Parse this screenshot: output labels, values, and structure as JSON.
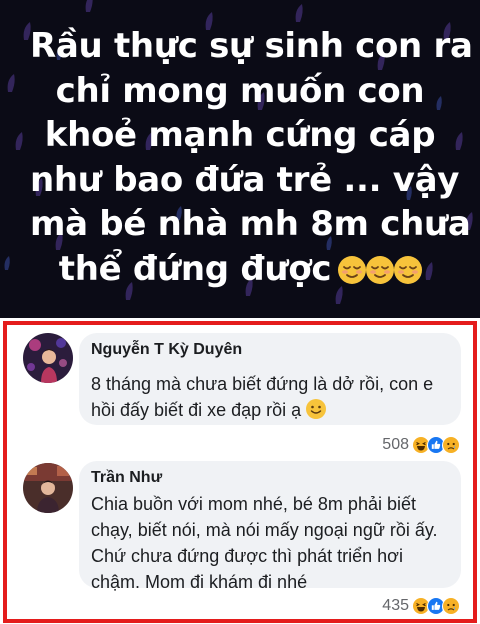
{
  "post": {
    "text_lines": [
      "Rầu thực sự sinh con ra",
      "chỉ mong muốn con",
      "khoẻ mạnh cứng cáp",
      "như bao đứa trẻ ... vậy",
      "mà bé nhà mh 8m  chưa",
      "thể đứng được"
    ],
    "trailing_emoji": "relieved-face-icon",
    "trailing_emoji_count": 3,
    "background_color": "#0b0b16",
    "text_color": "#ffffff"
  },
  "highlight_border_color": "#e41c1c",
  "comments": [
    {
      "author": "Nguyễn T Kỳ Duyên",
      "text_lines": [
        "8 tháng mà chưa biết đứng là dở rồi, con e",
        "hồi đấy biết đi xe đạp rồi ạ"
      ],
      "trailing_emoji": "slightly-smiling-face-icon",
      "reaction_count": "508",
      "reactions": [
        "haha-icon",
        "like-icon",
        "sad-icon"
      ]
    },
    {
      "author": "Trần Như",
      "text_lines": [
        "Chia buồn với mom nhé, bé 8m phải biết",
        "chạy, biết nói, mà nói mấy ngoại ngữ rồi ấy.",
        "Chứ chưa đứng được thì phát triển hơi",
        "chậm. Mom đi khám đi nhé"
      ],
      "reaction_count": "435",
      "reactions": [
        "haha-icon",
        "like-icon",
        "sad-icon"
      ]
    }
  ],
  "colors": {
    "bubble": "#f0f2f5",
    "like_blue": "#1877f2",
    "emoji_yellow": "#f7b125",
    "meta_gray": "#65676b"
  }
}
